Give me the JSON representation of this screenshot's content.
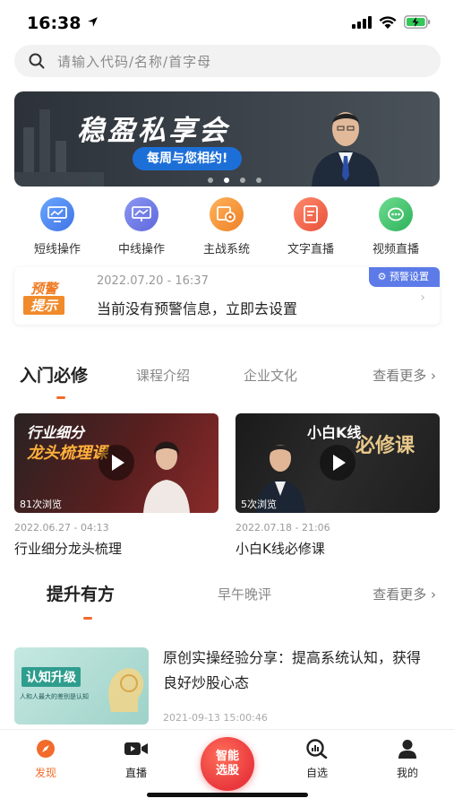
{
  "status_bar": {
    "time": "16:38"
  },
  "search": {
    "placeholder": "请输入代码/名称/首字母"
  },
  "banner": {
    "title": "稳盈私享会",
    "subtitle": "每周与您相约!",
    "slide_count": 4,
    "active_slide": 2
  },
  "quick_menu": [
    {
      "label": "短线操作",
      "icon": "monitor-chart-icon",
      "color": "#4f8cf0"
    },
    {
      "label": "中线操作",
      "icon": "monitor-trend-icon",
      "color": "#6b7fe6"
    },
    {
      "label": "主战系统",
      "icon": "gear-chart-icon",
      "color": "#f2913a"
    },
    {
      "label": "文字直播",
      "icon": "document-icon",
      "color": "#ef6a4e"
    },
    {
      "label": "视频直播",
      "icon": "headset-chat-icon",
      "color": "#3fbf6a"
    }
  ],
  "alert": {
    "logo_top": "预警",
    "logo_bottom": "提示",
    "time": "2022.07.20 - 16:37",
    "message": "当前没有预警信息，立即去设置",
    "tag": "预警设置"
  },
  "section1": {
    "tabs": [
      "入门必修",
      "课程介绍",
      "企业文化"
    ],
    "more": "查看更多"
  },
  "videos": [
    {
      "thumb_title": "行业细分",
      "thumb_subtitle": "龙头梳理课",
      "views": "81次浏览",
      "date": "2022.06.27 - 04:13",
      "title": "行业细分龙头梳理"
    },
    {
      "thumb_title": "小白K线",
      "thumb_subtitle": "必修课",
      "views": "5次浏览",
      "date": "2022.07.18 - 21:06",
      "title": "小白K线必修课"
    }
  ],
  "section2": {
    "tabs": [
      "提升有方",
      "早午晚评"
    ],
    "more": "查看更多"
  },
  "article": {
    "thumb_title": "认知升级",
    "thumb_caption": "人和人最大的差别是认知",
    "title": "原创实操经验分享：提高系统认知，获得良好炒股心态",
    "date": "2021-09-13 15:00:46"
  },
  "tab_bar": {
    "items": [
      {
        "label": "发现",
        "icon": "compass-icon"
      },
      {
        "label": "直播",
        "icon": "video-camera-icon"
      },
      {
        "label": "智能选股",
        "icon": "smart-pick-icon"
      },
      {
        "label": "自选",
        "icon": "search-chart-icon"
      },
      {
        "label": "我的",
        "icon": "user-icon"
      }
    ],
    "active": 0
  },
  "colors": {
    "accent": "#f26b2a",
    "alert_tag": "#5d7be8",
    "center_button": "#e9383d"
  }
}
